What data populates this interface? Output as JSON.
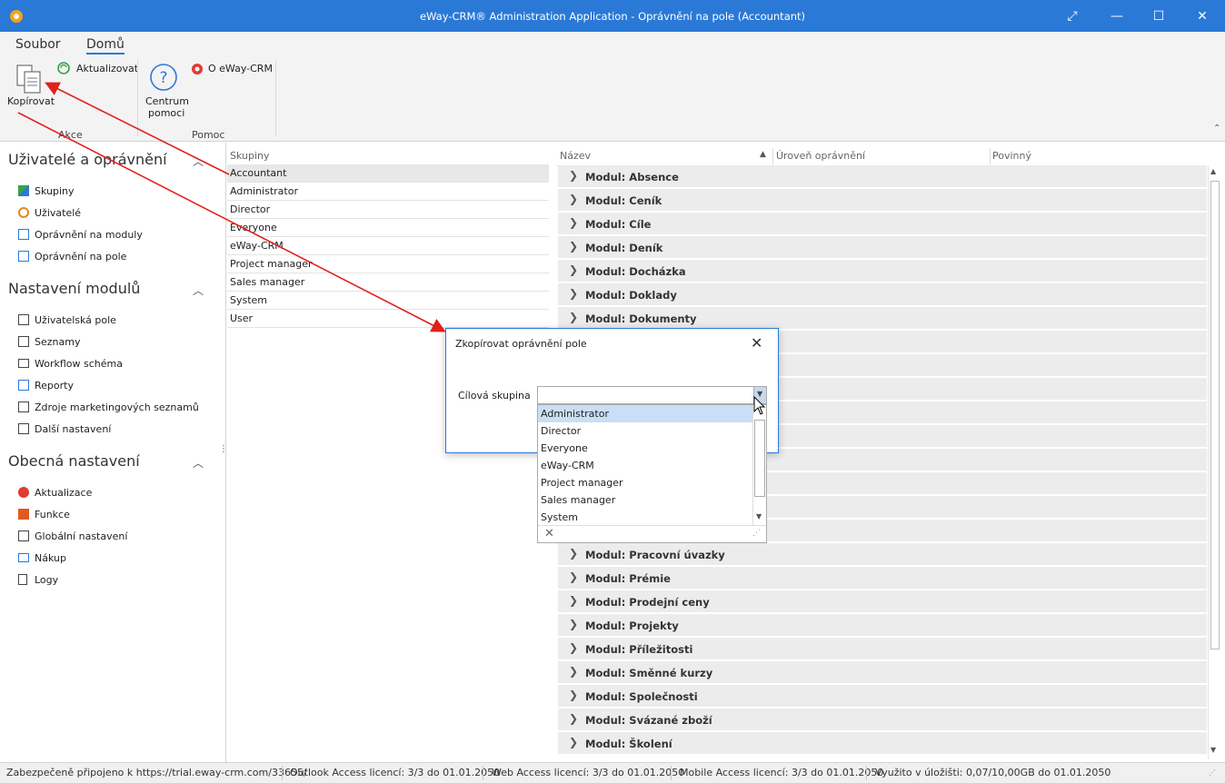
{
  "window": {
    "title": "eWay-CRM® Administration Application - Oprávnění na pole (Accountant)"
  },
  "ribbon": {
    "tabs": [
      "Soubor",
      "Domů"
    ],
    "copy_label": "Kopírovat",
    "refresh_label": "Aktualizovat",
    "help_label_1": "Centrum",
    "help_label_2": "pomoci",
    "about_label": "O eWay-CRM",
    "group_actions": "Akce",
    "group_help": "Pomoc"
  },
  "nav": {
    "section1": {
      "title": "Uživatelé a oprávnění",
      "items": [
        "Skupiny",
        "Uživatelé",
        "Oprávnění na moduly",
        "Oprávnění na pole"
      ]
    },
    "section2": {
      "title": "Nastavení modulů",
      "items": [
        "Uživatelská pole",
        "Seznamy",
        "Workflow schéma",
        "Reporty",
        "Zdroje marketingových seznamů",
        "Další nastavení"
      ]
    },
    "section3": {
      "title": "Obecná nastavení",
      "items": [
        "Aktualizace",
        "Funkce",
        "Globální nastavení",
        "Nákup",
        "Logy"
      ]
    }
  },
  "groups": {
    "header": "Skupiny",
    "rows": [
      "Accountant",
      "Administrator",
      "Director",
      "Everyone",
      "eWay-CRM",
      "Project manager",
      "Sales manager",
      "System",
      "User"
    ]
  },
  "fields": {
    "col_name": "Název",
    "col_level": "Úroveň oprávnění",
    "col_required": "Povinný",
    "rows_top": [
      "Modul: Absence",
      "Modul: Ceník",
      "Modul: Cíle",
      "Modul: Deník",
      "Modul: Docházka",
      "Modul: Doklady",
      "Modul: Dokumenty"
    ],
    "rows_bottom": [
      "Modul: Pracovní úvazky",
      "Modul: Prémie",
      "Modul: Prodejní ceny",
      "Modul: Projekty",
      "Modul: Příležitosti",
      "Modul: Směnné kurzy",
      "Modul: Společnosti",
      "Modul: Svázané zboží",
      "Modul: Školení"
    ]
  },
  "dialog": {
    "title": "Zkopírovat oprávnění pole",
    "label": "Cílová skupina",
    "options": [
      "Administrator",
      "Director",
      "Everyone",
      "eWay-CRM",
      "Project manager",
      "Sales manager",
      "System"
    ],
    "highlighted": "Administrator"
  },
  "status": {
    "connection": "Zabezpečeně připojeno k https://trial.eway-crm.com/33655/",
    "outlook": "Outlook Access licencí: 3/3 do 01.01.2050",
    "web": "Web Access licencí: 3/3 do 01.01.2050",
    "mobile": "Mobile Access licencí: 3/3 do 01.01.2050",
    "storage": "Využito v úložišti: 0,07/10,00GB do 01.01.2050"
  },
  "colors": {
    "accent": "#2b79d7",
    "annotation_arrow": "#e0201b"
  }
}
